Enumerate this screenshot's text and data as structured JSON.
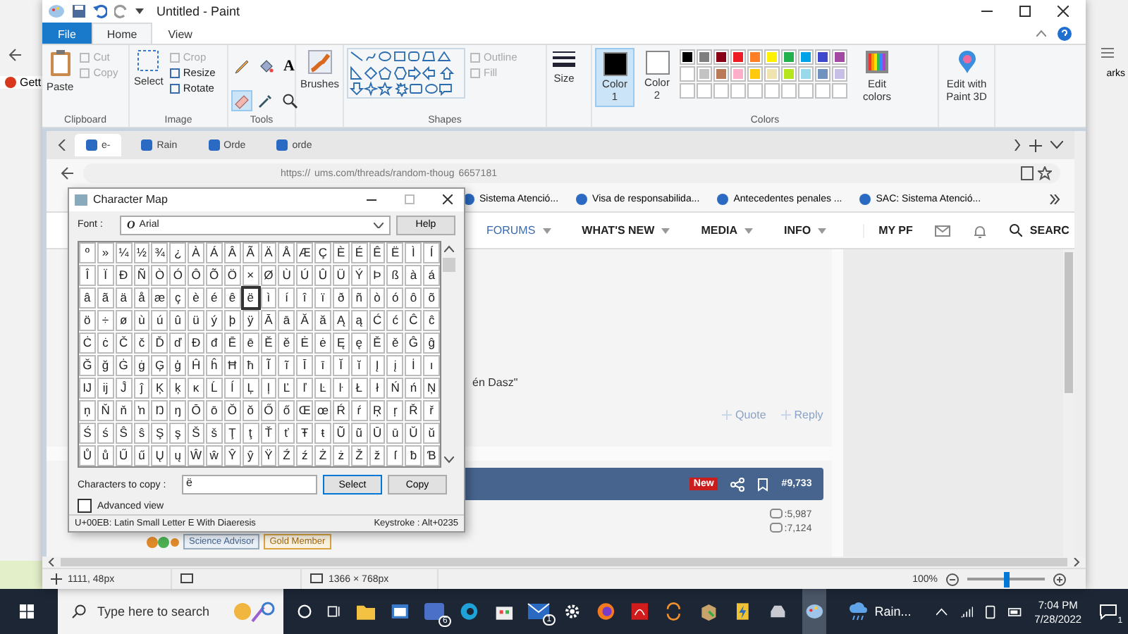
{
  "background_left": {
    "label": "Gett"
  },
  "background_right": {
    "label": "arks"
  },
  "paint": {
    "title": "Untitled - Paint",
    "tabs": [
      {
        "label": "File",
        "kind": "file",
        "selected": false
      },
      {
        "label": "Home",
        "kind": "tab",
        "selected": true
      },
      {
        "label": "View",
        "kind": "tab",
        "selected": false
      }
    ],
    "clipboard": {
      "group": "Clipboard",
      "paste": "Paste",
      "items": [
        {
          "label": "Cut",
          "disabled": true
        },
        {
          "label": "Copy",
          "disabled": true
        }
      ]
    },
    "image": {
      "group": "Image",
      "select": "Select",
      "items": [
        {
          "label": "Crop",
          "disabled": true
        },
        {
          "label": "Resize",
          "disabled": false
        },
        {
          "label": "Rotate",
          "disabled": false
        }
      ]
    },
    "tools": {
      "group": "Tools",
      "text_tool": "A"
    },
    "brushes": {
      "label": "Brushes"
    },
    "shapes": {
      "group": "Shapes",
      "options": [
        {
          "label": "Outline",
          "disabled": true
        },
        {
          "label": "Fill",
          "disabled": true
        }
      ]
    },
    "size": {
      "label": "Size"
    },
    "active_colors": [
      {
        "label": "Color",
        "number": "1",
        "color": "#000000",
        "selected": true
      },
      {
        "label": "Color",
        "number": "2",
        "color": "#ffffff",
        "selected": false
      }
    ],
    "palette": [
      {
        "color": "#000000"
      },
      {
        "color": "#7f7f7f"
      },
      {
        "color": "#880015"
      },
      {
        "color": "#ed1c24"
      },
      {
        "color": "#ff7f27"
      },
      {
        "color": "#fff200"
      },
      {
        "color": "#22b14c"
      },
      {
        "color": "#00a2e8"
      },
      {
        "color": "#3f48cc"
      },
      {
        "color": "#a349a4"
      },
      {
        "color": "#ffffff"
      },
      {
        "color": "#c3c3c3"
      },
      {
        "color": "#b97a57"
      },
      {
        "color": "#ffaec9"
      },
      {
        "color": "#ffc90e"
      },
      {
        "color": "#efe4b0"
      },
      {
        "color": "#b5e61d"
      },
      {
        "color": "#99d9ea"
      },
      {
        "color": "#7092be"
      },
      {
        "color": "#c8bfe7"
      }
    ],
    "colors_group": "Colors",
    "edit_colors": "Edit colors",
    "paint3d": "Edit with Paint 3D",
    "status": {
      "position": "1111, 48px",
      "dimensions": "1366 × 768px",
      "zoom": "100%",
      "zoom_level": {
        "level": 0.5
      }
    }
  },
  "snapshot": {
    "tabs": [
      {
        "label": "e-",
        "selected": true
      },
      {
        "label": "Rain",
        "selected": false
      },
      {
        "label": "Orde",
        "selected": false
      },
      {
        "label": "orde",
        "selected": false
      }
    ],
    "url_parts": [
      "https://",
      "ums.com/threads/random-thoug",
      "6657181"
    ],
    "bookmarks": [
      "Sistema Atenció...",
      "Visa de responsabilida...",
      "Antecedentes penales ...",
      "SAC: Sistema Atenció..."
    ],
    "nav": [
      {
        "label": "FORUMS",
        "selected": true
      },
      {
        "label": "WHAT'S NEW",
        "selected": false
      },
      {
        "label": "MEDIA",
        "selected": false
      },
      {
        "label": "INFO",
        "selected": false
      }
    ],
    "account": "MY PF",
    "search": "SEARC",
    "quote_tail": "én Dasz\"",
    "actions": [
      "Quote",
      "Reply"
    ],
    "post_badge": "New",
    "post_number": "#9,733",
    "stats": [
      ":5,987",
      ":7,124"
    ],
    "user_badges": [
      "Science Advisor",
      "Gold Member"
    ]
  },
  "charmap": {
    "title": "Character Map",
    "font_label": "Font :",
    "font_icon": "O",
    "font": "Arial",
    "help": "Help",
    "grid": [
      [
        {
          "char": "º",
          "selected": false
        },
        {
          "char": "»",
          "selected": false
        },
        {
          "char": "¼",
          "selected": false
        },
        {
          "char": "½",
          "selected": false
        },
        {
          "char": "¾",
          "selected": false
        },
        {
          "char": "¿",
          "selected": false
        },
        {
          "char": "À",
          "selected": false
        },
        {
          "char": "Á",
          "selected": false
        },
        {
          "char": "Â",
          "selected": false
        },
        {
          "char": "Ã",
          "selected": false
        },
        {
          "char": "Ä",
          "selected": false
        },
        {
          "char": "Å",
          "selected": false
        },
        {
          "char": "Æ",
          "selected": false
        },
        {
          "char": "Ç",
          "selected": false
        },
        {
          "char": "È",
          "selected": false
        },
        {
          "char": "É",
          "selected": false
        },
        {
          "char": "Ê",
          "selected": false
        },
        {
          "char": "Ë",
          "selected": false
        },
        {
          "char": "Ì",
          "selected": false
        },
        {
          "char": "Í",
          "selected": false
        }
      ],
      [
        {
          "char": "Î",
          "selected": false
        },
        {
          "char": "Ï",
          "selected": false
        },
        {
          "char": "Ð",
          "selected": false
        },
        {
          "char": "Ñ",
          "selected": false
        },
        {
          "char": "Ò",
          "selected": false
        },
        {
          "char": "Ó",
          "selected": false
        },
        {
          "char": "Ô",
          "selected": false
        },
        {
          "char": "Õ",
          "selected": false
        },
        {
          "char": "Ö",
          "selected": false
        },
        {
          "char": "×",
          "selected": false
        },
        {
          "char": "Ø",
          "selected": false
        },
        {
          "char": "Ù",
          "selected": false
        },
        {
          "char": "Ú",
          "selected": false
        },
        {
          "char": "Û",
          "selected": false
        },
        {
          "char": "Ü",
          "selected": false
        },
        {
          "char": "Ý",
          "selected": false
        },
        {
          "char": "Þ",
          "selected": false
        },
        {
          "char": "ß",
          "selected": false
        },
        {
          "char": "à",
          "selected": false
        },
        {
          "char": "á",
          "selected": false
        }
      ],
      [
        {
          "char": "â",
          "selected": false
        },
        {
          "char": "ã",
          "selected": false
        },
        {
          "char": "ä",
          "selected": false
        },
        {
          "char": "å",
          "selected": false
        },
        {
          "char": "æ",
          "selected": false
        },
        {
          "char": "ç",
          "selected": false
        },
        {
          "char": "è",
          "selected": false
        },
        {
          "char": "é",
          "selected": false
        },
        {
          "char": "ê",
          "selected": false
        },
        {
          "char": "ë",
          "selected": true
        },
        {
          "char": "ì",
          "selected": false
        },
        {
          "char": "í",
          "selected": false
        },
        {
          "char": "î",
          "selected": false
        },
        {
          "char": "ï",
          "selected": false
        },
        {
          "char": "ð",
          "selected": false
        },
        {
          "char": "ñ",
          "selected": false
        },
        {
          "char": "ò",
          "selected": false
        },
        {
          "char": "ó",
          "selected": false
        },
        {
          "char": "ô",
          "selected": false
        },
        {
          "char": "õ",
          "selected": false
        }
      ],
      [
        {
          "char": "ö",
          "selected": false
        },
        {
          "char": "÷",
          "selected": false
        },
        {
          "char": "ø",
          "selected": false
        },
        {
          "char": "ù",
          "selected": false
        },
        {
          "char": "ú",
          "selected": false
        },
        {
          "char": "û",
          "selected": false
        },
        {
          "char": "ü",
          "selected": false
        },
        {
          "char": "ý",
          "selected": false
        },
        {
          "char": "þ",
          "selected": false
        },
        {
          "char": "ÿ",
          "selected": false
        },
        {
          "char": "Ā",
          "selected": false
        },
        {
          "char": "ā",
          "selected": false
        },
        {
          "char": "Ă",
          "selected": false
        },
        {
          "char": "ă",
          "selected": false
        },
        {
          "char": "Ą",
          "selected": false
        },
        {
          "char": "ą",
          "selected": false
        },
        {
          "char": "Ć",
          "selected": false
        },
        {
          "char": "ć",
          "selected": false
        },
        {
          "char": "Ĉ",
          "selected": false
        },
        {
          "char": "ĉ",
          "selected": false
        }
      ],
      [
        {
          "char": "Ċ",
          "selected": false
        },
        {
          "char": "ċ",
          "selected": false
        },
        {
          "char": "Č",
          "selected": false
        },
        {
          "char": "č",
          "selected": false
        },
        {
          "char": "Ď",
          "selected": false
        },
        {
          "char": "ď",
          "selected": false
        },
        {
          "char": "Đ",
          "selected": false
        },
        {
          "char": "đ",
          "selected": false
        },
        {
          "char": "Ē",
          "selected": false
        },
        {
          "char": "ē",
          "selected": false
        },
        {
          "char": "Ĕ",
          "selected": false
        },
        {
          "char": "ĕ",
          "selected": false
        },
        {
          "char": "Ė",
          "selected": false
        },
        {
          "char": "ė",
          "selected": false
        },
        {
          "char": "Ę",
          "selected": false
        },
        {
          "char": "ę",
          "selected": false
        },
        {
          "char": "Ě",
          "selected": false
        },
        {
          "char": "ě",
          "selected": false
        },
        {
          "char": "Ĝ",
          "selected": false
        },
        {
          "char": "ĝ",
          "selected": false
        }
      ],
      [
        {
          "char": "Ğ",
          "selected": false
        },
        {
          "char": "ğ",
          "selected": false
        },
        {
          "char": "Ġ",
          "selected": false
        },
        {
          "char": "ġ",
          "selected": false
        },
        {
          "char": "Ģ",
          "selected": false
        },
        {
          "char": "ģ",
          "selected": false
        },
        {
          "char": "Ĥ",
          "selected": false
        },
        {
          "char": "ĥ",
          "selected": false
        },
        {
          "char": "Ħ",
          "selected": false
        },
        {
          "char": "ħ",
          "selected": false
        },
        {
          "char": "Ĩ",
          "selected": false
        },
        {
          "char": "ĩ",
          "selected": false
        },
        {
          "char": "Ī",
          "selected": false
        },
        {
          "char": "ī",
          "selected": false
        },
        {
          "char": "Ĭ",
          "selected": false
        },
        {
          "char": "ĭ",
          "selected": false
        },
        {
          "char": "Į",
          "selected": false
        },
        {
          "char": "į",
          "selected": false
        },
        {
          "char": "İ",
          "selected": false
        },
        {
          "char": "ı",
          "selected": false
        }
      ],
      [
        {
          "char": "Ĳ",
          "selected": false
        },
        {
          "char": "ĳ",
          "selected": false
        },
        {
          "char": "Ĵ",
          "selected": false
        },
        {
          "char": "ĵ",
          "selected": false
        },
        {
          "char": "Ķ",
          "selected": false
        },
        {
          "char": "ķ",
          "selected": false
        },
        {
          "char": "ĸ",
          "selected": false
        },
        {
          "char": "Ĺ",
          "selected": false
        },
        {
          "char": "ĺ",
          "selected": false
        },
        {
          "char": "Ļ",
          "selected": false
        },
        {
          "char": "ļ",
          "selected": false
        },
        {
          "char": "Ľ",
          "selected": false
        },
        {
          "char": "ľ",
          "selected": false
        },
        {
          "char": "Ŀ",
          "selected": false
        },
        {
          "char": "ŀ",
          "selected": false
        },
        {
          "char": "Ł",
          "selected": false
        },
        {
          "char": "ł",
          "selected": false
        },
        {
          "char": "Ń",
          "selected": false
        },
        {
          "char": "ń",
          "selected": false
        },
        {
          "char": "Ņ",
          "selected": false
        }
      ],
      [
        {
          "char": "ņ",
          "selected": false
        },
        {
          "char": "Ň",
          "selected": false
        },
        {
          "char": "ň",
          "selected": false
        },
        {
          "char": "ŉ",
          "selected": false
        },
        {
          "char": "Ŋ",
          "selected": false
        },
        {
          "char": "ŋ",
          "selected": false
        },
        {
          "char": "Ō",
          "selected": false
        },
        {
          "char": "ō",
          "selected": false
        },
        {
          "char": "Ŏ",
          "selected": false
        },
        {
          "char": "ŏ",
          "selected": false
        },
        {
          "char": "Ő",
          "selected": false
        },
        {
          "char": "ő",
          "selected": false
        },
        {
          "char": "Œ",
          "selected": false
        },
        {
          "char": "œ",
          "selected": false
        },
        {
          "char": "Ŕ",
          "selected": false
        },
        {
          "char": "ŕ",
          "selected": false
        },
        {
          "char": "Ŗ",
          "selected": false
        },
        {
          "char": "ŗ",
          "selected": false
        },
        {
          "char": "Ř",
          "selected": false
        },
        {
          "char": "ř",
          "selected": false
        }
      ],
      [
        {
          "char": "Ś",
          "selected": false
        },
        {
          "char": "ś",
          "selected": false
        },
        {
          "char": "Ŝ",
          "selected": false
        },
        {
          "char": "ŝ",
          "selected": false
        },
        {
          "char": "Ş",
          "selected": false
        },
        {
          "char": "ş",
          "selected": false
        },
        {
          "char": "Š",
          "selected": false
        },
        {
          "char": "š",
          "selected": false
        },
        {
          "char": "Ţ",
          "selected": false
        },
        {
          "char": "ţ",
          "selected": false
        },
        {
          "char": "Ť",
          "selected": false
        },
        {
          "char": "ť",
          "selected": false
        },
        {
          "char": "Ŧ",
          "selected": false
        },
        {
          "char": "ŧ",
          "selected": false
        },
        {
          "char": "Ũ",
          "selected": false
        },
        {
          "char": "ũ",
          "selected": false
        },
        {
          "char": "Ū",
          "selected": false
        },
        {
          "char": "ū",
          "selected": false
        },
        {
          "char": "Ŭ",
          "selected": false
        },
        {
          "char": "ŭ",
          "selected": false
        }
      ],
      [
        {
          "char": "Ů",
          "selected": false
        },
        {
          "char": "ů",
          "selected": false
        },
        {
          "char": "Ű",
          "selected": false
        },
        {
          "char": "ű",
          "selected": false
        },
        {
          "char": "Ų",
          "selected": false
        },
        {
          "char": "ų",
          "selected": false
        },
        {
          "char": "Ŵ",
          "selected": false
        },
        {
          "char": "ŵ",
          "selected": false
        },
        {
          "char": "Ŷ",
          "selected": false
        },
        {
          "char": "ŷ",
          "selected": false
        },
        {
          "char": "Ÿ",
          "selected": false
        },
        {
          "char": "Ź",
          "selected": false
        },
        {
          "char": "ź",
          "selected": false
        },
        {
          "char": "Ż",
          "selected": false
        },
        {
          "char": "ż",
          "selected": false
        },
        {
          "char": "Ž",
          "selected": false
        },
        {
          "char": "ž",
          "selected": false
        },
        {
          "char": "ſ",
          "selected": false
        },
        {
          "char": "ƀ",
          "selected": false
        },
        {
          "char": "Ɓ",
          "selected": false
        }
      ]
    ],
    "copy_label": "Characters to copy :",
    "copy_value": "ë",
    "select": "Select",
    "copy": "Copy",
    "advanced": {
      "label": "Advanced view",
      "checked": false
    },
    "status": "U+00EB: Latin Small Letter E With Diaeresis",
    "keystroke": "Keystroke : Alt+0235"
  },
  "taskbar": {
    "search_placeholder": "Type here to search",
    "mail_badge": "6",
    "inbox_badge": "1",
    "weather": "Rain...",
    "time": "7:04 PM",
    "date": "7/28/2022",
    "notifications": "1"
  }
}
